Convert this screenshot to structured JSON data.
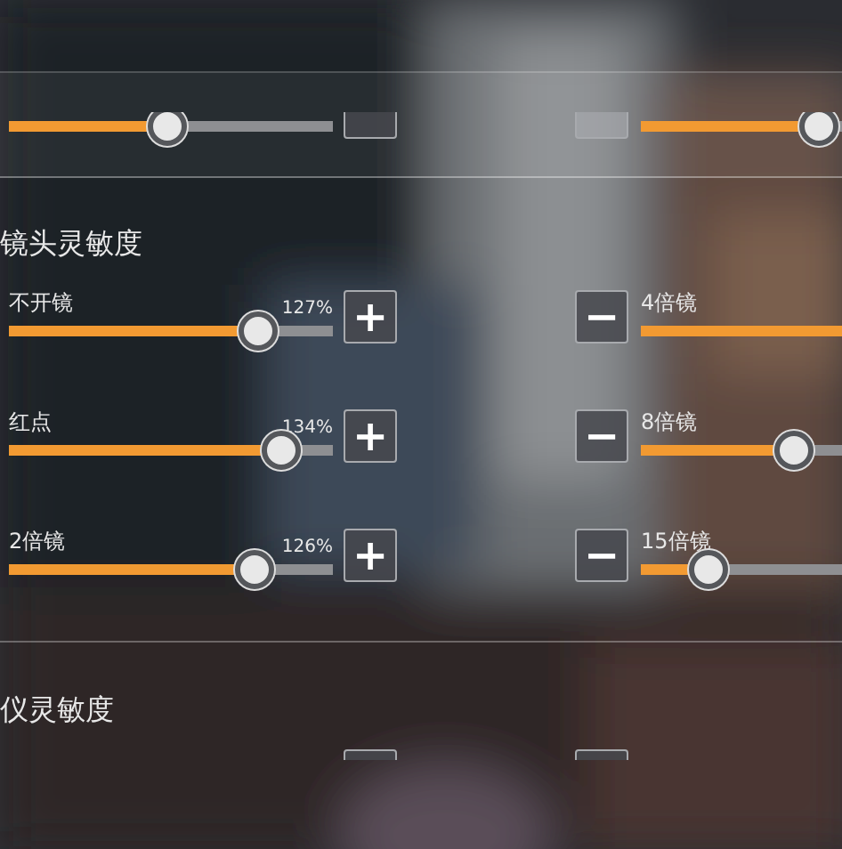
{
  "top_row": {
    "left": {
      "level": 0.49
    },
    "right": {
      "level": 0.55
    }
  },
  "sections": [
    {
      "title": "镜头灵敏度",
      "rows": [
        {
          "left": {
            "label": "不开镜",
            "reading": "127%",
            "level": 0.77,
            "button": "+"
          },
          "right": {
            "label": "4倍镜",
            "level": 0.7,
            "button": "−"
          }
        },
        {
          "left": {
            "label": "红点",
            "reading": "134%",
            "level": 0.84,
            "button": "+"
          },
          "right": {
            "label": "8倍镜",
            "level": 0.47,
            "button": "−"
          }
        },
        {
          "left": {
            "label": "2倍镜",
            "reading": "126%",
            "level": 0.76,
            "button": "+"
          },
          "right": {
            "label": "15倍镜",
            "level": 0.21,
            "button": "−"
          }
        }
      ]
    },
    {
      "title": "仪灵敏度"
    }
  ]
}
